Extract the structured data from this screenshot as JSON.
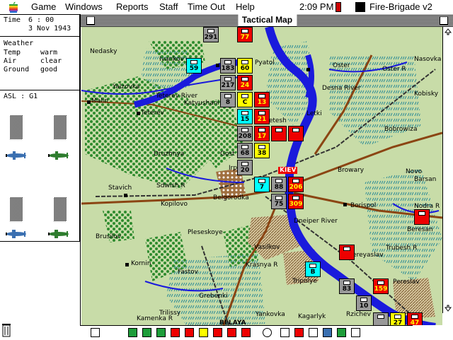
{
  "menubar": {
    "items": [
      "Game",
      "Windows",
      "Reports",
      "Staff",
      "Time Out",
      "Help"
    ],
    "clock": "2:09 PM",
    "app_name": "Fire-Brigade v2"
  },
  "status_panel": {
    "time_label": "Time",
    "time_value": "6 : 00",
    "date": "3 Nov 1943",
    "weather_label": "Weather",
    "temp_label": "Temp",
    "temp_value": "warm",
    "air_label": "Air",
    "air_value": "clear",
    "ground_label": "Ground",
    "ground_value": "good",
    "asl_label": "ASL : G1"
  },
  "window": {
    "title": "Tactical Map"
  },
  "colors": {
    "terrain": "#c8dca8",
    "river": "#1a1adc",
    "forest": "#2e8b2e",
    "marsh": "#3aa6a0",
    "road": "#8b4513",
    "rail": "#333333",
    "soviet": "#e00000",
    "german": "#999999"
  },
  "map": {
    "places": [
      {
        "name": "Nedasky"
      },
      {
        "name": "Ivankov"
      },
      {
        "name": "Oster"
      },
      {
        "name": "Oster R"
      },
      {
        "name": "Nasovka"
      },
      {
        "name": "Yalzovka"
      },
      {
        "name": "Teterev"
      },
      {
        "name": "Teterev River"
      },
      {
        "name": "Katyushani"
      },
      {
        "name": "Desna River"
      },
      {
        "name": "Malin"
      },
      {
        "name": "Letki"
      },
      {
        "name": "Kobisky"
      },
      {
        "name": "Bobrowiza"
      },
      {
        "name": "Druzhnya"
      },
      {
        "name": "Gost"
      },
      {
        "name": "Irpen R"
      },
      {
        "name": "KIEV"
      },
      {
        "name": "Browary"
      },
      {
        "name": "Novo"
      },
      {
        "name": "Barsan"
      },
      {
        "name": "Stavich"
      },
      {
        "name": "Sdwish R"
      },
      {
        "name": "Kopilovo"
      },
      {
        "name": "Belgorodka"
      },
      {
        "name": "Borispol"
      },
      {
        "name": "Nodra R"
      },
      {
        "name": "Beresan"
      },
      {
        "name": "Trubesh R"
      },
      {
        "name": "Brusilov"
      },
      {
        "name": "Pleseskoye"
      },
      {
        "name": "Dneiper River"
      },
      {
        "name": "Vasilkov"
      },
      {
        "name": "Pereyaslav"
      },
      {
        "name": "Kornin"
      },
      {
        "name": "Krasnya R"
      },
      {
        "name": "Fastov"
      },
      {
        "name": "Tripolye"
      },
      {
        "name": "Grebenki"
      },
      {
        "name": "Pereslav"
      },
      {
        "name": "Trilissy"
      },
      {
        "name": "Kamenka R"
      },
      {
        "name": "Yankovka"
      },
      {
        "name": "Kagarlyk"
      },
      {
        "name": "Rzichev"
      },
      {
        "name": "BELAYA"
      },
      {
        "name": "Pyatol"
      },
      {
        "name": "Letesh"
      }
    ],
    "units": [
      {
        "id": "291",
        "side": "german"
      },
      {
        "id": "77",
        "side": "soviet"
      },
      {
        "id": "59",
        "side": "cyan"
      },
      {
        "id": "183",
        "side": "german"
      },
      {
        "id": "60",
        "side": "yellow"
      },
      {
        "id": "217",
        "side": "german"
      },
      {
        "id": "24",
        "side": "soviet"
      },
      {
        "id": "8",
        "side": "german"
      },
      {
        "id": "C",
        "side": "yellow"
      },
      {
        "id": "13",
        "side": "soviet"
      },
      {
        "id": "15",
        "side": "cyan"
      },
      {
        "id": "21",
        "side": "soviet"
      },
      {
        "id": "208",
        "side": "german"
      },
      {
        "id": "17",
        "side": "soviet"
      },
      {
        "id": "68",
        "side": "german"
      },
      {
        "id": "38",
        "side": "yellow"
      },
      {
        "id": "20",
        "side": "german"
      },
      {
        "id": "7",
        "side": "cyan"
      },
      {
        "id": "88",
        "side": "german"
      },
      {
        "id": "206",
        "side": "soviet"
      },
      {
        "id": "75",
        "side": "german"
      },
      {
        "id": "309",
        "side": "soviet"
      },
      {
        "id": "B",
        "side": "cyan"
      },
      {
        "id": "83",
        "side": "german"
      },
      {
        "id": "159",
        "side": "soviet"
      },
      {
        "id": "10",
        "side": "german"
      },
      {
        "id": "27",
        "side": "yellow"
      },
      {
        "id": "47",
        "side": "soviet"
      }
    ]
  },
  "toolbar": {
    "buttons": [
      "phone-icon",
      "spacer",
      "unit-green-icon",
      "unit-green-icon",
      "unit-green-icon",
      "unit-red-icon",
      "unit-red-icon",
      "unit-yellow-icon",
      "unit-red-icon",
      "unit-red-icon",
      "unit-red-icon",
      "spacer",
      "target-icon",
      "move-icon",
      "cancel-icon",
      "cross-icon",
      "rotate-icon",
      "rotate-icon",
      "rotate-icon"
    ]
  }
}
